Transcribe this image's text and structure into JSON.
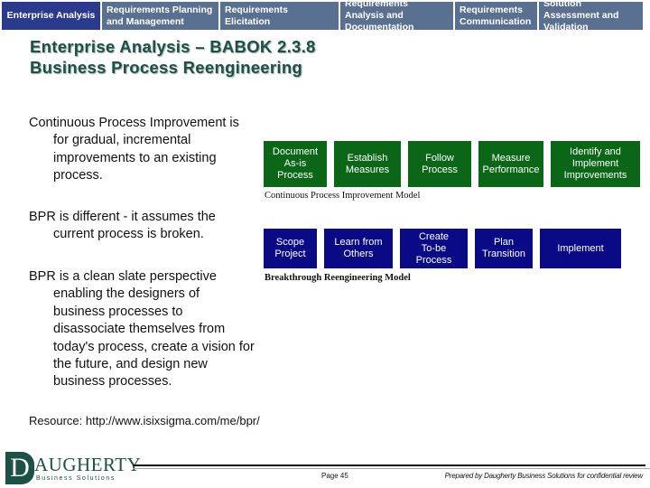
{
  "tabs": [
    {
      "label": "Enterprise Analysis",
      "active": true
    },
    {
      "label": "Requirements Planning and Management",
      "active": false
    },
    {
      "label": "Requirements Elicitation",
      "active": false
    },
    {
      "label": "Requirements Analysis and Documentation",
      "active": false
    },
    {
      "label": "Requirements Communication",
      "active": false
    },
    {
      "label": "Solution Assessment and Validation",
      "active": false
    }
  ],
  "title": {
    "line1": "Enterprise Analysis – BABOK 2.3.8",
    "line2": "Business Process Reengineering"
  },
  "body": {
    "paragraph1": "Continuous Process Improvement is for gradual, incremental improvements to an existing process.",
    "paragraph2": "BPR is different - it assumes the current process is broken.",
    "paragraph3": "BPR is a clean slate perspective enabling the designers of business processes to disassociate themselves from today's process, create a vision for the future, and design new business processes.",
    "resource": "Resource: http://www.isixsigma.com/me/bpr/"
  },
  "continuous_model": {
    "caption": "Continuous Process Improvement Model",
    "color": "#0b6618",
    "steps": [
      "Document\nAs-is\nProcess",
      "Establish\nMeasures",
      "Follow\nProcess",
      "Measure\nPerformance",
      "Identify and\nImplement\nImprovements"
    ]
  },
  "breakthrough_model": {
    "caption": "Breakthrough Reengineering Model",
    "color": "#0a0a86",
    "steps": [
      "Scope\nProject",
      "Learn from\nOthers",
      "Create\nTo-be\nProcess",
      "Plan\nTransition",
      "Implement"
    ]
  },
  "footer": {
    "logo_main": "AUGHERTY",
    "logo_initial": "D",
    "logo_sub": "Business Solutions",
    "page": "Page 45",
    "prepared": "Prepared by Daugherty Business Solutions for confidential review"
  }
}
